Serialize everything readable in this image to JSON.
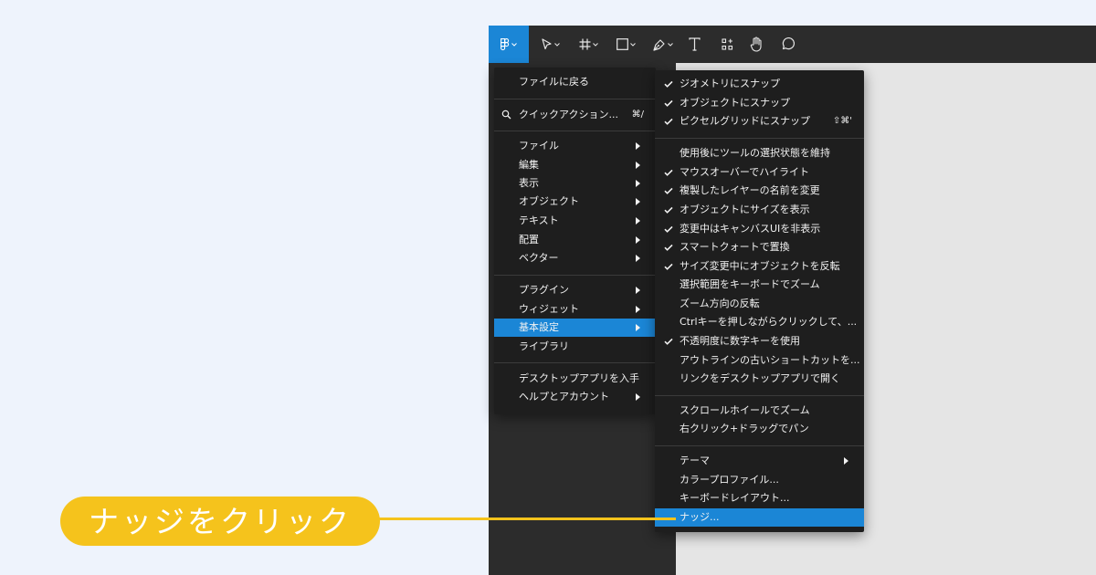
{
  "colors": {
    "accent": "#1b86d6",
    "callout": "#f5c31c",
    "menu_bg": "#1e1e1e",
    "toolbar_bg": "#2c2c2c",
    "canvas_bg": "#e5e5e5",
    "page_bg": "#eef3fc"
  },
  "toolbar": {
    "tools": [
      {
        "icon": "figma-main-menu-icon",
        "active": true
      },
      {
        "icon": "move-tool-icon"
      },
      {
        "icon": "frame-tool-icon"
      },
      {
        "icon": "shape-tool-icon"
      },
      {
        "icon": "pen-tool-icon"
      },
      {
        "icon": "text-tool-icon"
      },
      {
        "icon": "resources-icon"
      },
      {
        "icon": "hand-tool-icon"
      },
      {
        "icon": "comment-tool-icon"
      }
    ]
  },
  "main_menu": {
    "back_to_files": "ファイルに戻る",
    "quick_actions": "クイックアクション...",
    "quick_actions_shortcut": "⌘/",
    "items_group1": [
      "ファイル",
      "編集",
      "表示",
      "オブジェクト",
      "テキスト",
      "配置",
      "ベクター"
    ],
    "plugins": "プラグイン",
    "widgets": "ウィジェット",
    "preferences": "基本設定",
    "libraries": "ライブラリ",
    "get_desktop_app": "デスクトップアプリを入手",
    "help_account": "ヘルプとアカウント"
  },
  "preferences_menu": {
    "snap_geometry": "ジオメトリにスナップ",
    "snap_objects": "オブジェクトにスナップ",
    "snap_pixel_grid": "ピクセルグリッドにスナップ",
    "snap_pixel_grid_shortcut": "⇧⌘'",
    "keep_tool_selected": "使用後にツールの選択状態を維持",
    "highlight_on_hover": "マウスオーバーでハイライト",
    "rename_duplicated": "複製したレイヤーの名前を変更",
    "show_dimensions": "オブジェクトにサイズを表示",
    "hide_canvas_ui": "変更中はキャンバスUIを非表示",
    "smart_quotes": "スマートクォートで置換",
    "flip_on_resize": "サイズ変更中にオブジェクトを反転",
    "keyboard_zoom_selection": "選択範囲をキーボードでズーム",
    "invert_zoom": "ズーム方向の反転",
    "ctrl_click": "Ctrlキーを押しながらクリックして、...",
    "opacity_number_keys": "不透明度に数字キーを使用",
    "legacy_outline_shortcuts": "アウトラインの古いショートカットを...",
    "open_links_desktop": "リンクをデスクトップアプリで開く",
    "scroll_zoom": "スクロールホイールでズーム",
    "right_click_pan": "右クリック+ドラッグでパン",
    "theme": "テーマ",
    "color_profile": "カラープロファイル...",
    "keyboard_layout": "キーボードレイアウト...",
    "nudge": "ナッジ..."
  },
  "callout": {
    "text": "ナッジをクリック"
  }
}
